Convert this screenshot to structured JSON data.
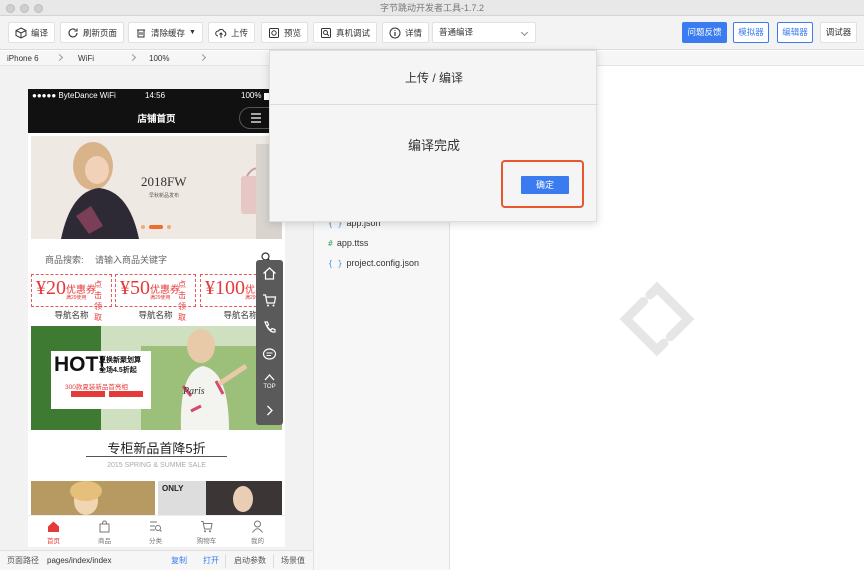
{
  "window": {
    "title": "字节跳动开发者工具-1.7.2"
  },
  "toolbar": {
    "compile": "编译",
    "refresh": "刷新页面",
    "clear_cache": "清除缓存",
    "upload": "上传",
    "preview": "预览",
    "remote_debug": "真机调试",
    "details": "详情",
    "compile_mode": "普通编译",
    "feedback": "问题反馈",
    "simulator": "模拟器",
    "editor": "编辑器",
    "debugger": "调试器"
  },
  "device": {
    "model": "iPhone 6",
    "network": "WiFi",
    "zoom": "100%"
  },
  "phone": {
    "status_carrier": "●●●●● ByteDance WiFi",
    "status_time": "14:56",
    "status_battery": "100%",
    "nav_title": "店铺首页",
    "banner_text": "2018FW",
    "banner_sub": "早秋新品发布",
    "search_label": "商品搜索:",
    "search_placeholder": "请输入商品关键字",
    "coupons": [
      {
        "amount": "¥20",
        "word": "优惠券",
        "sub": "满29使用",
        "get": "点击领取"
      },
      {
        "amount": "¥50",
        "word": "优惠券",
        "sub": "满29使用",
        "get": "点击领取"
      },
      {
        "amount": "¥100",
        "word": "优惠券",
        "sub": "满29使用",
        "get": "点击"
      }
    ],
    "nav_names": [
      "导航名称",
      "导航名称",
      "导航名称"
    ],
    "promo_hot": "HOT!",
    "promo_line1": "夏换新聚划算",
    "promo_line2": "全场4.5折起",
    "promo_line3": "300款夏装新品首亮相",
    "promo_brand": "Paris",
    "section_title": "专柜新品首降5折",
    "section_sub": "2015 SPRING & SUMME SALE",
    "thumb2_label": "ONLY",
    "float_top": "TOP",
    "tabs": [
      "首页",
      "商品",
      "分类",
      "购物车",
      "我的"
    ]
  },
  "bottombar": {
    "path_label": "页面路径",
    "path_value": "pages/index/index",
    "copy": "复制",
    "open": "打开",
    "launch_params": "启动参数",
    "scene": "场景值"
  },
  "files": [
    {
      "icon": "{ }",
      "name": "app.json"
    },
    {
      "icon": "#",
      "name": "app.ttss"
    },
    {
      "icon": "{ }",
      "name": "project.config.json"
    }
  ],
  "dialog": {
    "title": "上传 / 编译",
    "message": "编译完成",
    "ok": "确定"
  },
  "colors": {
    "accent": "#3a7bf0",
    "highlight": "#e8572d",
    "coupon": "#e53a3a"
  }
}
